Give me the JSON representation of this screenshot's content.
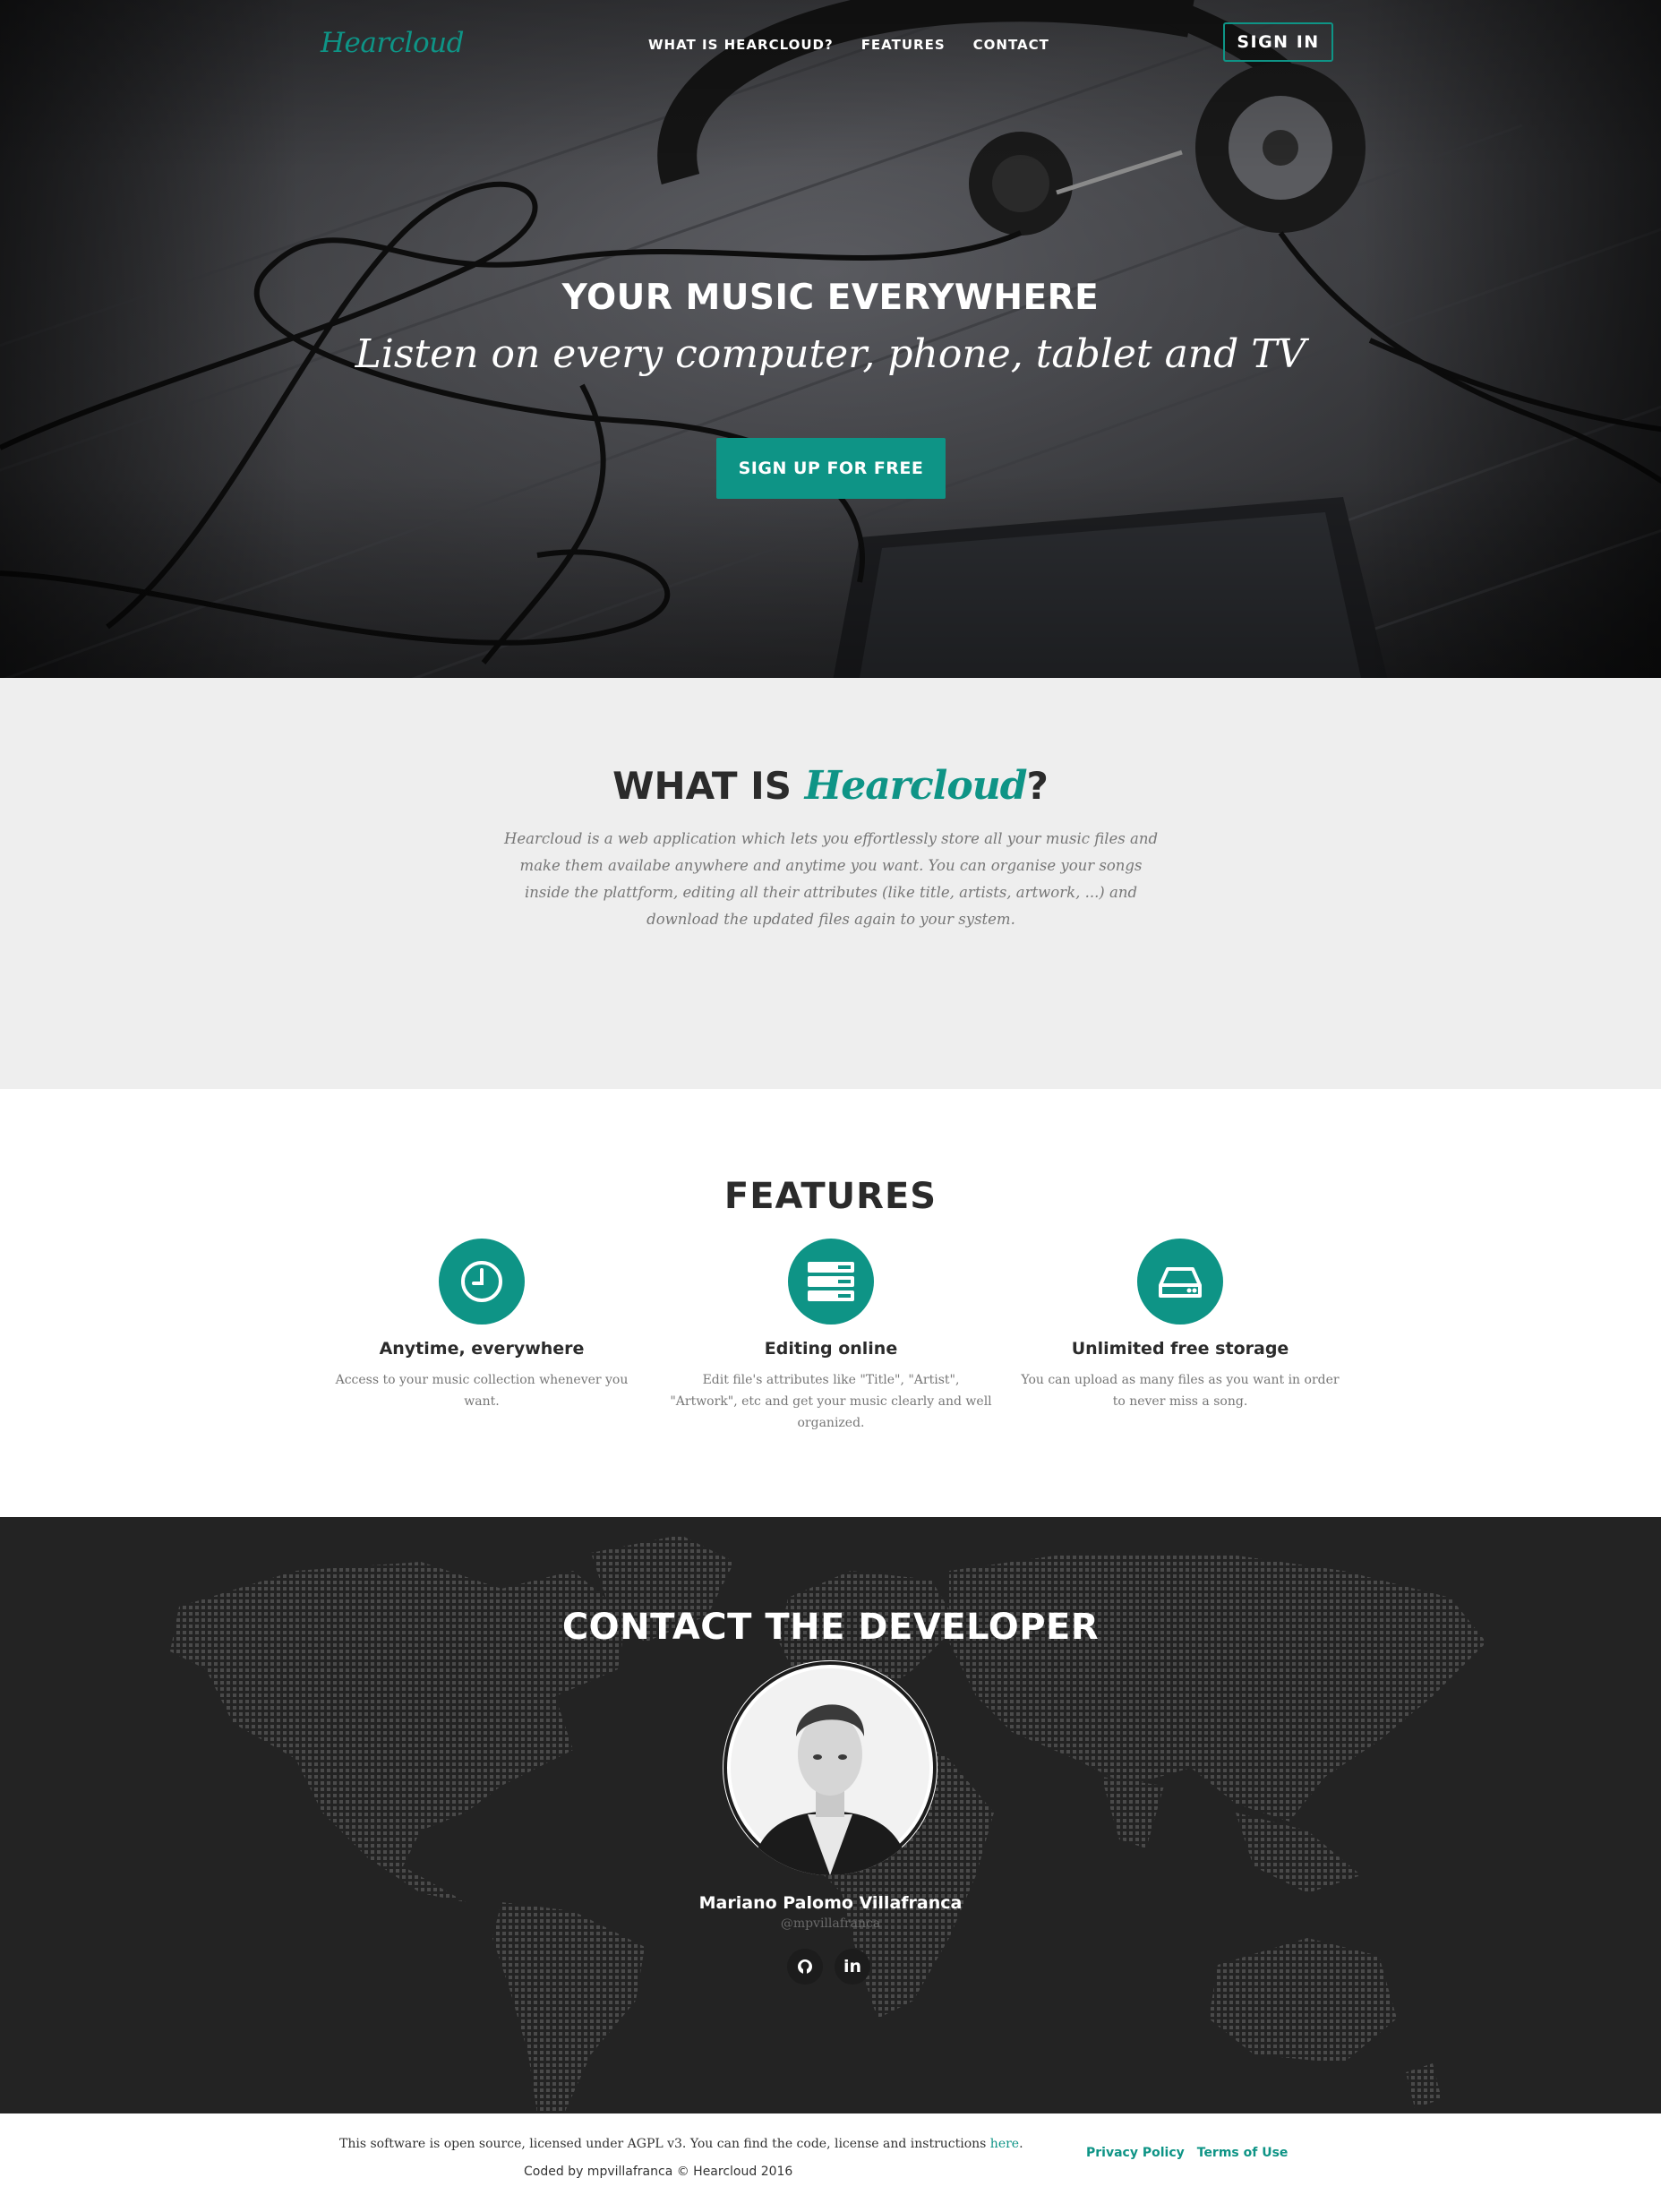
{
  "brand": {
    "logo_text": "Hearcloud",
    "accent_color": "#0e9486"
  },
  "nav": {
    "items": [
      {
        "label": "WHAT IS HEARCLOUD?"
      },
      {
        "label": "FEATURES"
      },
      {
        "label": "CONTACT"
      }
    ],
    "signin_label": "SIGN IN"
  },
  "hero": {
    "title": "YOUR MUSIC EVERYWHERE",
    "subtitle": "Listen on every computer, phone, tablet and TV",
    "cta_label": "SIGN UP FOR FREE"
  },
  "what_is": {
    "title_prefix": "WHAT IS",
    "title_brand": "Hearcloud",
    "title_suffix": "?",
    "description": "Hearcloud is a web application which lets you effortlessly store all your music files and make them availabe anywhere and anytime you want. You can organise your songs inside the plattform, editing all their attributes (like title, artists, artwork, ...) and download the updated files again to your system."
  },
  "features": {
    "title": "FEATURES",
    "items": [
      {
        "icon": "clock-icon",
        "title": "Anytime, everywhere",
        "text": "Access to your music collection whenever you want."
      },
      {
        "icon": "server-icon",
        "title": "Editing online",
        "text": "Edit file's attributes like \"Title\", \"Artist\", \"Artwork\", etc and get your music clearly and well organized."
      },
      {
        "icon": "hard-drive-icon",
        "title": "Unlimited free storage",
        "text": "You can upload as many files as you want in order to never miss a song."
      }
    ]
  },
  "contact": {
    "title": "CONTACT THE DEVELOPER",
    "name": "Mariano Palomo Villafranca",
    "handle": "@mpvillafranca",
    "social": [
      {
        "icon": "github-icon"
      },
      {
        "icon": "linkedin-icon",
        "text": "in"
      }
    ]
  },
  "footer": {
    "license_text": "This software is open source, licensed under AGPL v3. You can find the code, license and instructions ",
    "license_link": "here",
    "license_end": ".",
    "coded_by": "Coded by mpvillafranca © Hearcloud 2016",
    "links": [
      {
        "label": "Privacy Policy"
      },
      {
        "label": "Terms of Use"
      }
    ]
  }
}
